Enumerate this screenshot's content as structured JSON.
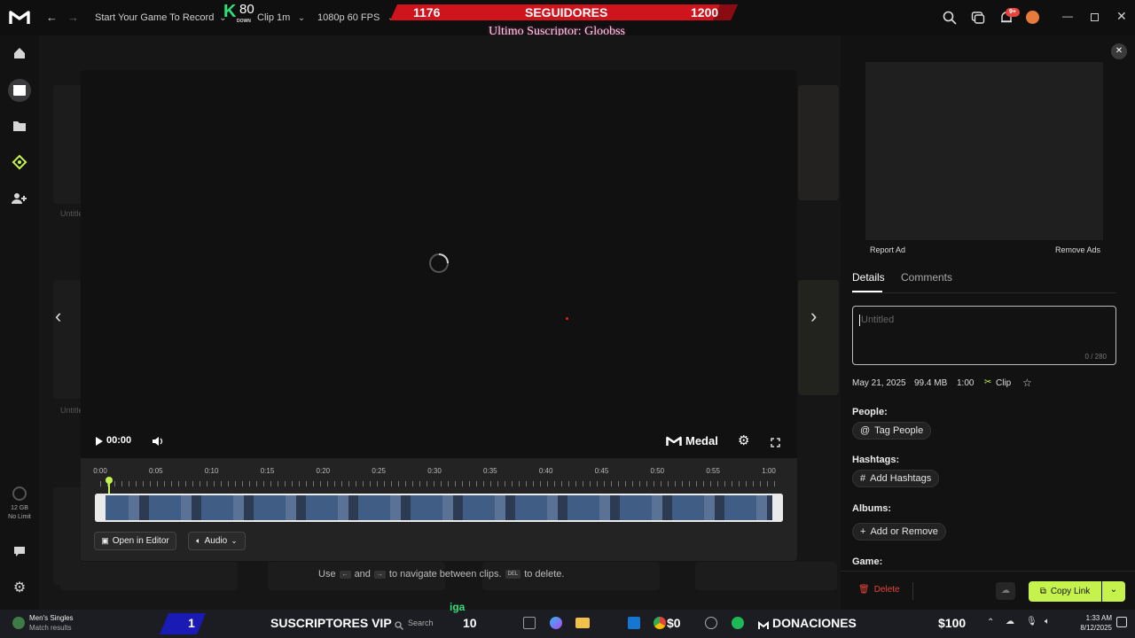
{
  "topbar": {
    "game": "Start Your Game To Record",
    "clip": "Clip 1m",
    "quality": "1080p 60 FPS",
    "counter_value": "80",
    "counter_sub": "DOWN",
    "banner": {
      "left": "1176",
      "center": "SEGUIDORES",
      "right": "1200"
    },
    "subscriber": "Ultimo Suscriptor: Gloobss",
    "notif_badge": "9+"
  },
  "sidebar": {
    "storage": "12 GB",
    "storage_limit": "No Limit"
  },
  "player": {
    "time": "00:00",
    "brand": "Medal",
    "ticks": [
      "0:00",
      "0:05",
      "0:10",
      "0:15",
      "0:20",
      "0:25",
      "0:30",
      "0:35",
      "0:40",
      "0:45",
      "0:50",
      "0:55",
      "1:00"
    ],
    "open_editor": "Open in Editor",
    "audio": "Audio"
  },
  "hint": {
    "use": "Use",
    "and": "and",
    "nav": "to navigate between clips.",
    "del_key": "DEL",
    "del": "to delete."
  },
  "panel": {
    "report_ad": "Report Ad",
    "remove_ads": "Remove Ads",
    "tabs": [
      "Details",
      "Comments"
    ],
    "title_placeholder": "Untitled",
    "char_count": "0 / 280",
    "meta": {
      "date": "May 21, 2025",
      "size": "99.4 MB",
      "duration": "1:00",
      "type": "Clip"
    },
    "people_label": "People:",
    "tag_people": "Tag People",
    "hashtags_label": "Hashtags:",
    "add_hashtags": "Add Hashtags",
    "albums_label": "Albums:",
    "add_remove": "Add or Remove",
    "game_label": "Game:",
    "delete": "Delete",
    "copy_link": "Copy Link"
  },
  "gallery": {
    "tile_label": "Untitled"
  },
  "taskbar": {
    "news_title": "Men's Singles",
    "news_sub": "Match results",
    "vip_count": "1",
    "vip_label": "SUSCRIPTORES VIP",
    "search": "Search",
    "ten": "10",
    "liga": "iga",
    "money_left": "$0",
    "donations": "DONACIONES",
    "money_right": "$100",
    "time": "1:33 AM",
    "date": "8/12/2025"
  },
  "colors": {
    "accent": "#c6f24e",
    "banner": "#d0141e",
    "badge": "#e5433b"
  }
}
